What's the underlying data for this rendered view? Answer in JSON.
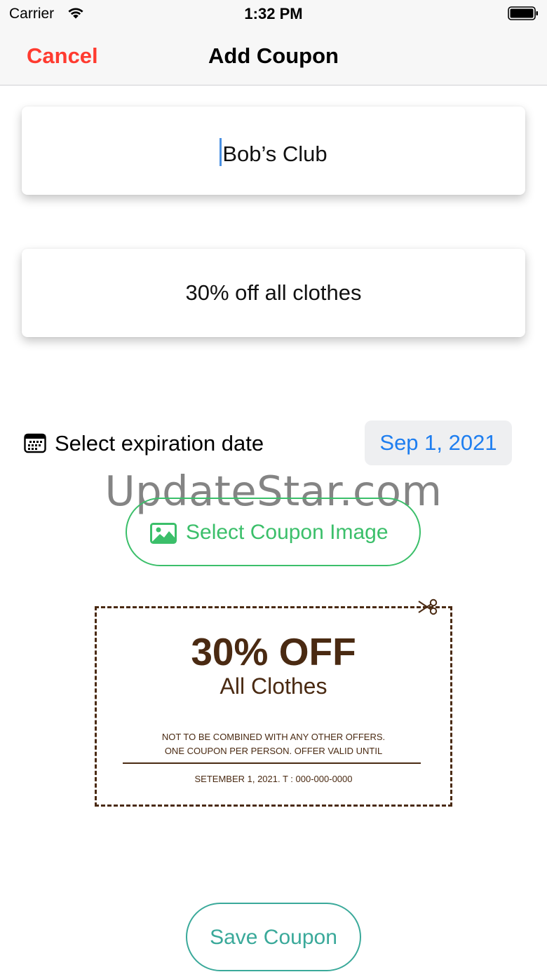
{
  "status_bar": {
    "carrier": "Carrier",
    "time": "1:32 PM",
    "wifi_icon": "wifi-icon",
    "battery_icon": "battery-icon"
  },
  "nav": {
    "cancel_label": "Cancel",
    "title": "Add Coupon"
  },
  "form": {
    "name_value": "Bob’s Club",
    "description_value": "30% off all clothes",
    "expiration_label": "Select expiration date",
    "expiration_icon": "calendar-icon",
    "expiration_value": "Sep 1, 2021",
    "select_image_label": "Select Coupon Image",
    "select_image_icon": "photo-icon",
    "save_label": "Save Coupon"
  },
  "coupon_image": {
    "headline": "30% OFF",
    "subline": "All Clothes",
    "fine_line_1": "NOT TO BE COMBINED WITH ANY OTHER OFFERS.",
    "fine_line_2": "ONE COUPON PER PERSON. OFFER VALID UNTIL",
    "fine_line_3": "SETEMBER 1, 2021.  T : 000-000-0000",
    "scissors_icon": "scissors-icon"
  },
  "watermark": "UpdateStar.com",
  "colors": {
    "cancel": "#ff3b30",
    "date_pill_text": "#1e7ef0",
    "image_button": "#3bbf6a",
    "save_button": "#3aa99a",
    "coupon_brown": "#4a2a12"
  }
}
